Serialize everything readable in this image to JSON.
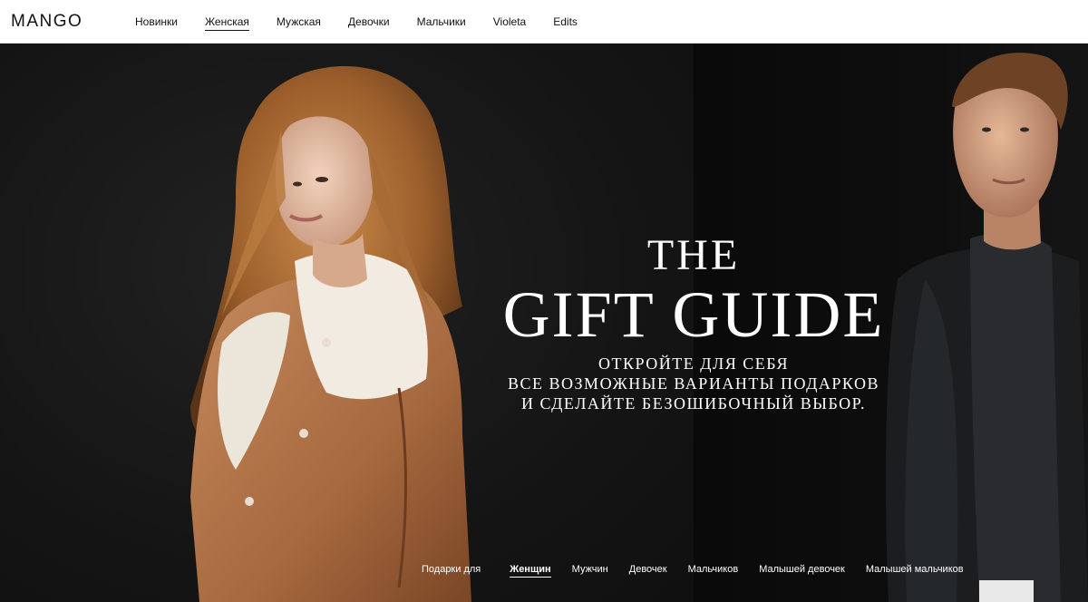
{
  "brand": {
    "logo_text": "MANGO"
  },
  "nav": {
    "items": [
      {
        "label": "Новинки",
        "active": false
      },
      {
        "label": "Женская",
        "active": true
      },
      {
        "label": "Мужская",
        "active": false
      },
      {
        "label": "Девочки",
        "active": false
      },
      {
        "label": "Мальчики",
        "active": false
      },
      {
        "label": "Violeta",
        "active": false
      },
      {
        "label": "Edits",
        "active": false
      }
    ]
  },
  "hero": {
    "title_line1": "THE",
    "title_line2": "GIFT GUIDE",
    "subtitle_lines": [
      "ОТКРОЙТЕ ДЛЯ СЕБЯ",
      "ВСЕ ВОЗМОЖНЫЕ ВАРИАНТЫ ПОДАРКОВ",
      "И СДЕЛАЙТЕ БЕЗОШИБОЧНЫЙ ВЫБОР."
    ]
  },
  "gift_nav": {
    "lead": "Подарки для",
    "items": [
      {
        "label": "Женщин",
        "active": true
      },
      {
        "label": "Мужчин",
        "active": false
      },
      {
        "label": "Девочек",
        "active": false
      },
      {
        "label": "Мальчиков",
        "active": false
      },
      {
        "label": "Малышей девочек",
        "active": false
      },
      {
        "label": "Малышей мальчиков",
        "active": false
      }
    ]
  },
  "colors": {
    "header_bg": "#ffffff",
    "hero_bg": "#141414",
    "text_dark": "#111111",
    "text_light": "#ffffff"
  }
}
